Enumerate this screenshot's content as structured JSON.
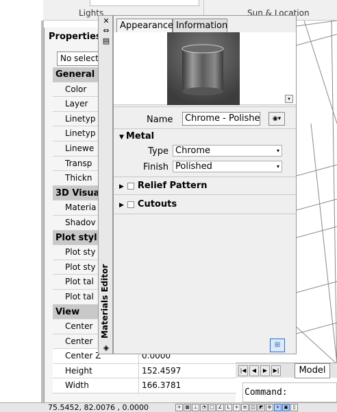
{
  "ribbon": {
    "sections": [
      "Lights",
      "Sun & Location"
    ]
  },
  "properties": {
    "title": "Properties",
    "selection": "No select",
    "categories": [
      {
        "name": "General",
        "rows": [
          "Color",
          "Layer",
          "Linetyp",
          "Linetyp",
          "Linewe",
          "Transp",
          "Thickn"
        ]
      },
      {
        "name": "3D Visua",
        "rows": [
          "Materia",
          "Shadov"
        ]
      },
      {
        "name": "Plot styl",
        "rows": [
          "Plot sty",
          "Plot sty",
          "Plot tal",
          "Plot tal"
        ]
      },
      {
        "name": "View",
        "rows": [
          "Center",
          "Center",
          "Center Z",
          "Height",
          "Width"
        ]
      }
    ],
    "values": {
      "center_z": "0.0000",
      "height": "152.4597",
      "width": "166.3781"
    }
  },
  "materials_editor": {
    "title": "Materials Editor",
    "tabs": [
      "Appearance",
      "Information"
    ],
    "name_label": "Name",
    "name_value": "Chrome - Polished",
    "metal_section": "Metal",
    "type_label": "Type",
    "type_value": "Chrome",
    "finish_label": "Finish",
    "finish_value": "Polished",
    "relief_section": "Relief Pattern",
    "cutouts_section": "Cutouts"
  },
  "model_tab": "Model",
  "command_prompt": "Command:",
  "status": {
    "coords": "75.5452,  82.0076 , 0.0000"
  },
  "colors": {
    "accent": "#2a6bd1",
    "category_bg": "#c8c8c8",
    "panel_bg": "#efefef"
  }
}
